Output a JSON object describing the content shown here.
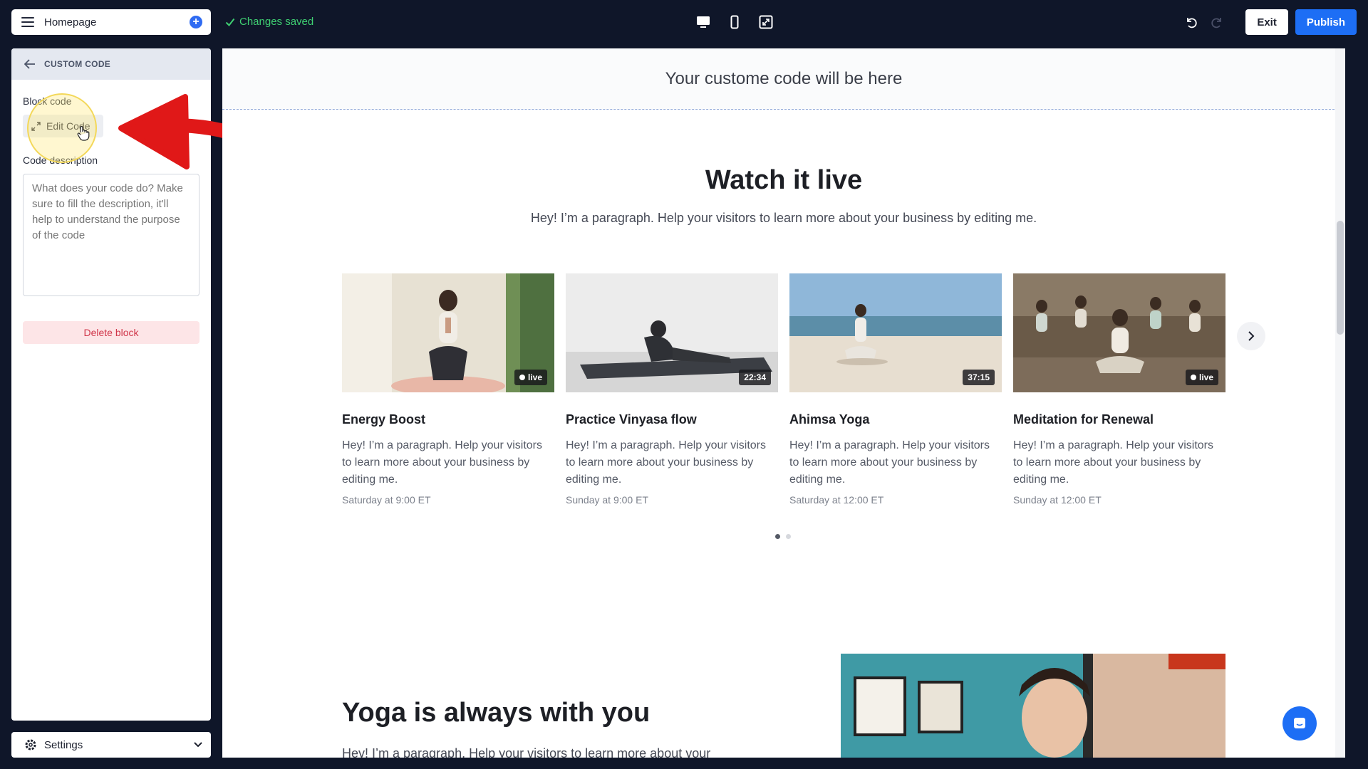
{
  "topbar": {
    "page_name": "Homepage",
    "save_status": "Changes saved",
    "exit_label": "Exit",
    "publish_label": "Publish",
    "accent": "#1d6ef5",
    "save_color": "#3fcf72"
  },
  "panel": {
    "header": "CUSTOM CODE",
    "block_code_label": "Block code",
    "edit_code_label": "Edit Code",
    "description_label": "Code description",
    "description_placeholder": "What does your code do? Make sure to fill the description, it'll help to understand the purpose of the code",
    "delete_label": "Delete block"
  },
  "settings": {
    "label": "Settings"
  },
  "canvas": {
    "code_placeholder": "Your custome code will be here",
    "live_heading": "Watch it live",
    "live_paragraph": "Hey! I’m a paragraph. Help your visitors to learn more about your business by editing me.",
    "cards": [
      {
        "title": "Energy Boost",
        "text": "Hey! I’m a paragraph. Help your visitors to learn more about your business by editing me.",
        "time": "Saturday at 9:00 ET",
        "badge": "live",
        "is_live": true
      },
      {
        "title": "Practice Vinyasa flow",
        "text": "Hey! I’m a paragraph. Help your visitors to learn more about your business by editing me.",
        "time": "Sunday at 9:00 ET",
        "badge": "22:34",
        "is_live": false
      },
      {
        "title": "Ahimsa Yoga",
        "text": "Hey! I’m a paragraph. Help your visitors to learn more about your business by editing me.",
        "time": "Saturday at 12:00 ET",
        "badge": "37:15",
        "is_live": false
      },
      {
        "title": "Meditation for Renewal",
        "text": "Hey! I’m a paragraph. Help your visitors to learn more about your business by editing me.",
        "time": "Sunday at 12:00 ET",
        "badge": "live",
        "is_live": true
      }
    ],
    "carousel_pages": 2,
    "carousel_active": 0,
    "yoga_heading": "Yoga is always with you",
    "yoga_paragraph": "Hey! I’m a paragraph. Help your visitors to learn more about your"
  }
}
